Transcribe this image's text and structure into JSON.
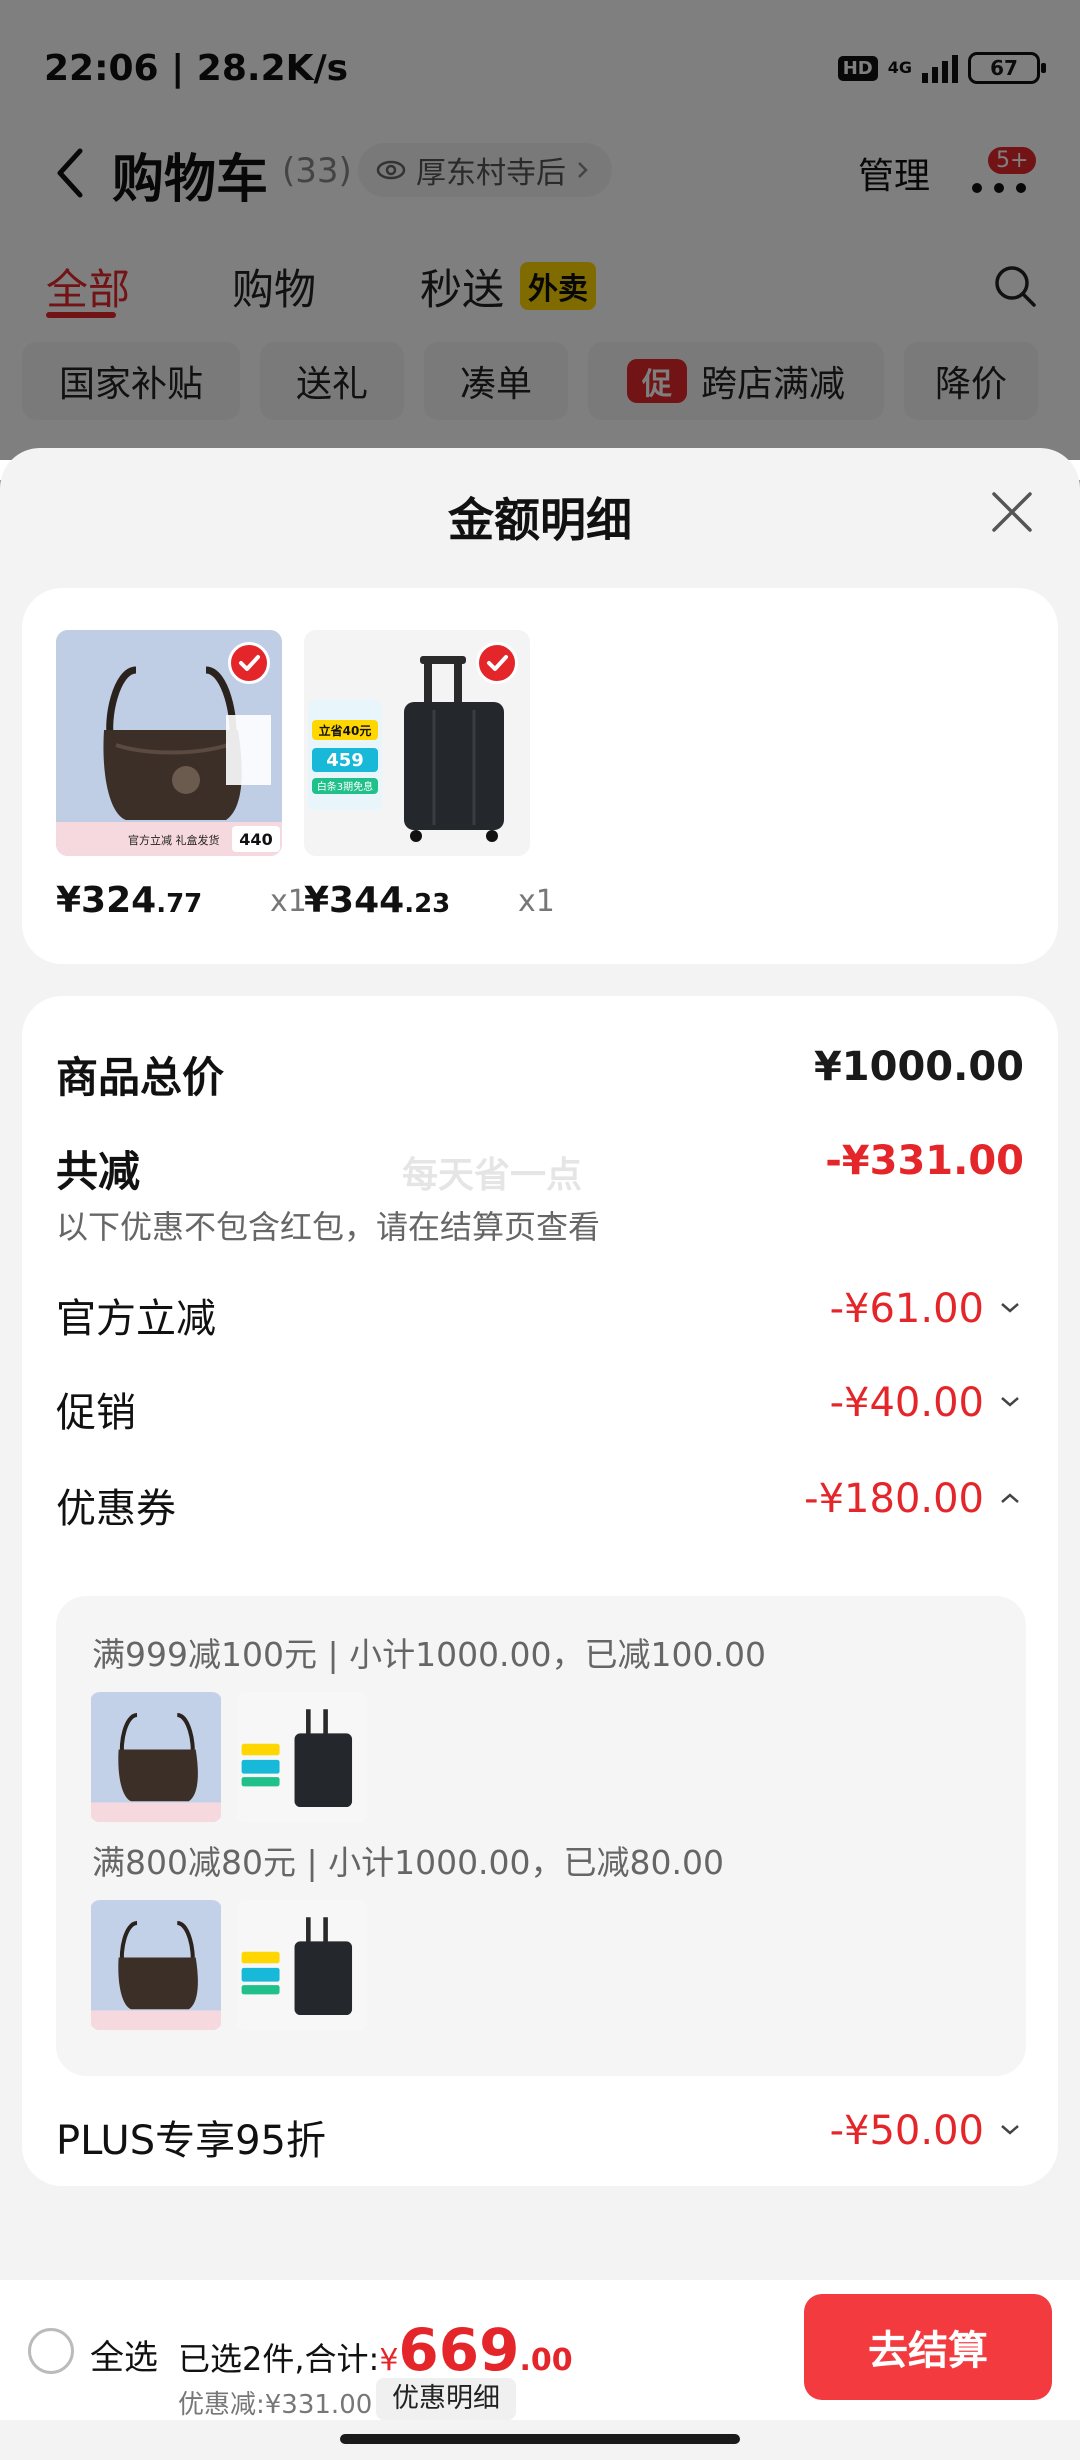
{
  "status_bar": {
    "time": "22:06 | 28.2K/s",
    "hd": "HD",
    "network": "4G",
    "battery": "67"
  },
  "nav": {
    "title": "购物车",
    "count": "(33)",
    "location": "厚东村寺后",
    "manage": "管理",
    "badge": "5+"
  },
  "tabs": [
    {
      "label": "全部",
      "active": true
    },
    {
      "label": "购物",
      "active": false
    },
    {
      "label": "秒送",
      "active": false
    }
  ],
  "takeout_badge": "外卖",
  "chips": [
    "国家补贴",
    "送礼",
    "凑单",
    "跨店满减",
    "降价"
  ],
  "promo_icon_text": "促",
  "sheet": {
    "title": "金额明细"
  },
  "products": [
    {
      "price_int": "¥324",
      "price_dec": ".77",
      "qty": "x1",
      "thumb_text": "440",
      "thumb_caption": "官方立减  礼盒发货"
    },
    {
      "price_int": "¥344",
      "price_dec": ".23",
      "qty": "x1",
      "thumb_tag": "立省40元",
      "thumb_num": "459",
      "thumb_text": "白条3期免息"
    }
  ],
  "details": {
    "total_label": "商品总价",
    "total_value": "¥1000.00",
    "reduce_label": "共减",
    "reduce_value": "-¥331.00",
    "watermark": "每天省一点",
    "note": "以下优惠不包含红包，请在结算页查看",
    "official_label": "官方立减",
    "official_value": "-¥61.00",
    "promo_label": "促销",
    "promo_value": "-¥40.00",
    "coupon_label": "优惠券",
    "coupon_value": "-¥180.00",
    "plus_label": "PLUS专享95折",
    "plus_value": "-¥50.00"
  },
  "coupons": [
    {
      "text": "满999减100元 | 小计1000.00，已减100.00"
    },
    {
      "text": "满800减80元 | 小计1000.00，已减80.00"
    }
  ],
  "bottom": {
    "select_all": "全选",
    "summary_prefix": "已选2件,合计:",
    "currency": "¥",
    "amount_int": "669",
    "amount_dec": ".00",
    "discount": "优惠减:¥331.00",
    "detail_chip": "优惠明细",
    "checkout": "去结算"
  },
  "colors": {
    "accent": "#e4262b",
    "checkout": "#f23a3f",
    "takeout_badge": "#ffd600"
  }
}
